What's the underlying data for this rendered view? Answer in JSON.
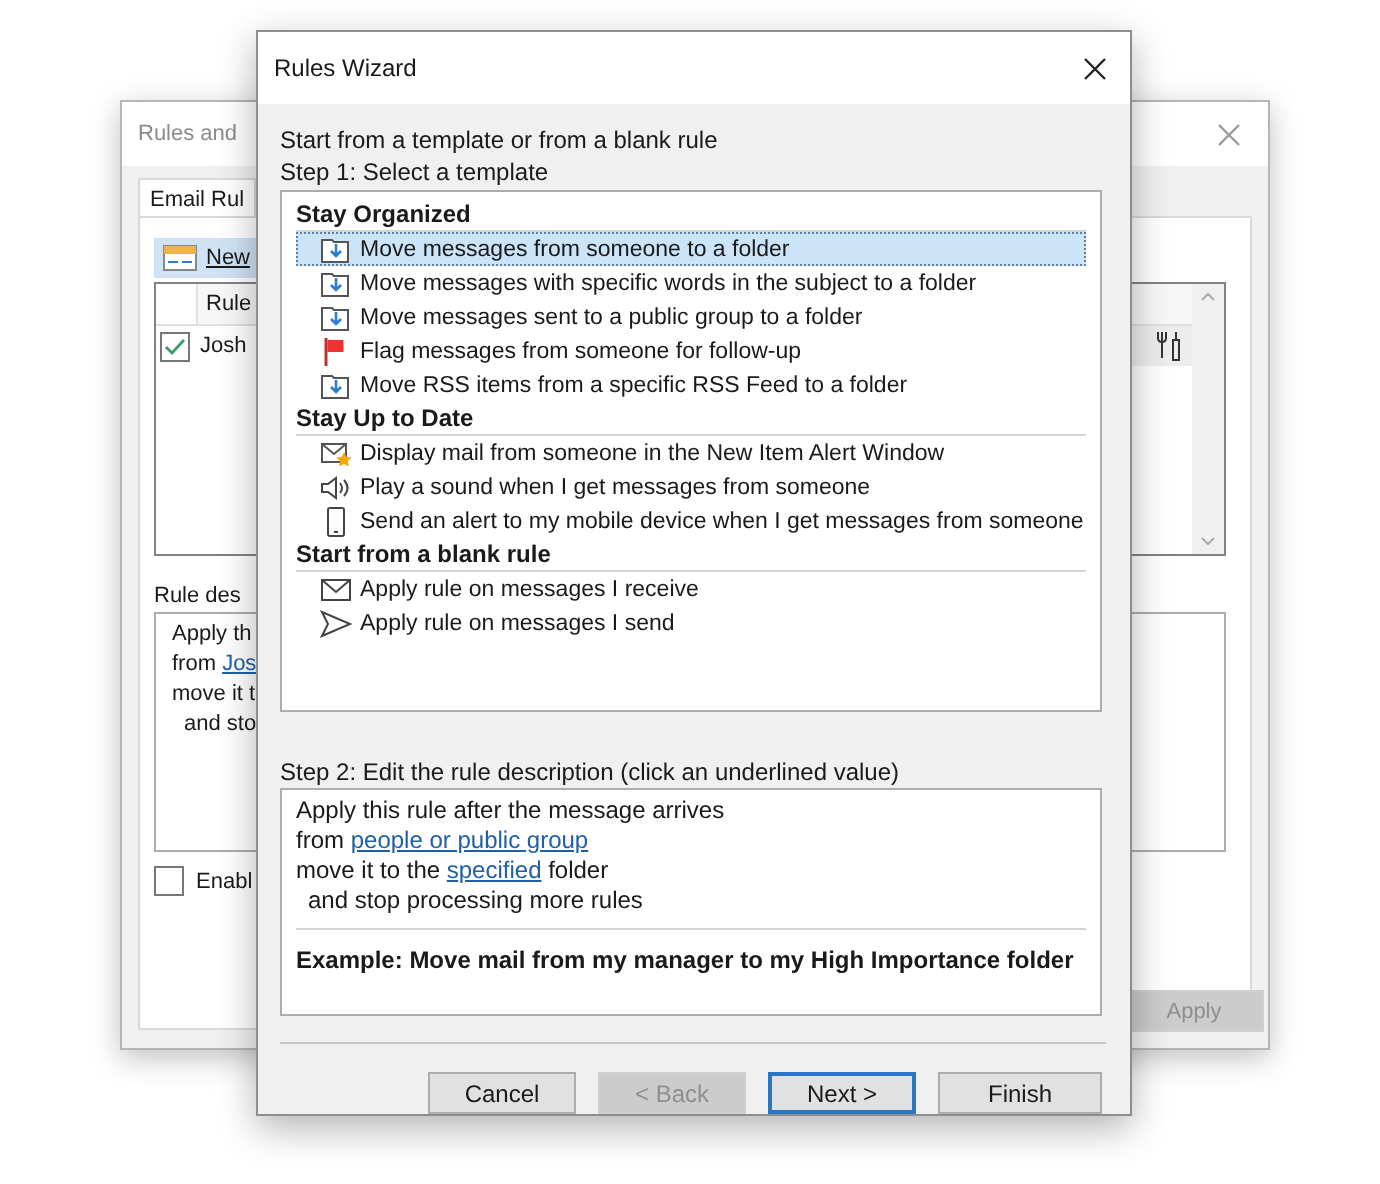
{
  "background_window": {
    "title": "Rules and",
    "tab": "Email Rul",
    "new_button": "New",
    "list": {
      "column": "Rule",
      "rows": [
        {
          "name": "Josh",
          "checked": true
        }
      ]
    },
    "description_label": "Rule des",
    "description_lines": [
      {
        "parts": [
          {
            "text": "Apply th"
          }
        ]
      },
      {
        "parts": [
          {
            "text": "from "
          },
          {
            "text": "Jos",
            "link": true
          }
        ]
      },
      {
        "parts": [
          {
            "text": "move it t"
          }
        ]
      },
      {
        "parts": [
          {
            "text": "and sto"
          }
        ],
        "indented": true
      }
    ],
    "enable": {
      "label": "Enabl",
      "checked": false
    },
    "apply_button": {
      "label": "Apply",
      "disabled": true
    }
  },
  "dialog": {
    "title": "Rules Wizard",
    "intro": "Start from a template or from a blank rule",
    "step1": "Step 1: Select a template",
    "groups": [
      {
        "title": "Stay Organized",
        "items": [
          {
            "label": "Move messages from someone to a folder",
            "kind": "move",
            "selected": true
          },
          {
            "label": "Move messages with specific words in the subject to a folder",
            "kind": "move",
            "selected": false
          },
          {
            "label": "Move messages sent to a public group to a folder",
            "kind": "move",
            "selected": false
          },
          {
            "label": "Flag messages from someone for follow-up",
            "kind": "flag",
            "selected": false
          },
          {
            "label": "Move RSS items from a specific RSS Feed to a folder",
            "kind": "move",
            "selected": false
          }
        ]
      },
      {
        "title": "Stay Up to Date",
        "items": [
          {
            "label": "Display mail from someone in the New Item Alert Window",
            "kind": "alert",
            "selected": false
          },
          {
            "label": "Play a sound when I get messages from someone",
            "kind": "sound",
            "selected": false
          },
          {
            "label": "Send an alert to my mobile device when I get messages from someone",
            "kind": "mobile",
            "selected": false
          }
        ]
      },
      {
        "title": "Start from a blank rule",
        "items": [
          {
            "label": "Apply rule on messages I receive",
            "kind": "envelope",
            "selected": false
          },
          {
            "label": "Apply rule on messages I send",
            "kind": "send",
            "selected": false
          }
        ]
      }
    ],
    "step2": "Step 2: Edit the rule description (click an underlined value)",
    "description_lines": [
      {
        "parts": [
          {
            "text": "Apply this rule after the message arrives"
          }
        ]
      },
      {
        "parts": [
          {
            "text": "from "
          },
          {
            "text": "people or public group",
            "link": true
          }
        ]
      },
      {
        "parts": [
          {
            "text": "move it to the "
          },
          {
            "text": "specified",
            "link": true
          },
          {
            "text": " folder"
          }
        ]
      },
      {
        "parts": [
          {
            "text": "and stop processing more rules"
          }
        ],
        "indented": true
      }
    ],
    "example": "Example: Move mail from my manager to my High Importance folder",
    "buttons": [
      {
        "label": "Cancel",
        "disabled": false,
        "default": false
      },
      {
        "label": "< Back",
        "disabled": true,
        "default": false
      },
      {
        "label": "Next >",
        "disabled": false,
        "default": true
      },
      {
        "label": "Finish",
        "disabled": false,
        "default": false
      }
    ]
  }
}
